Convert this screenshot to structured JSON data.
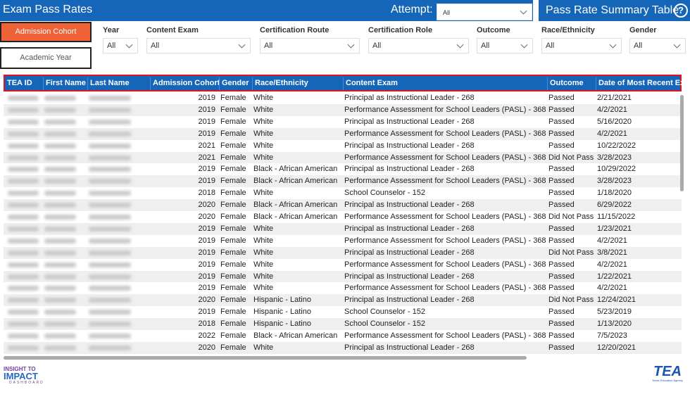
{
  "header": {
    "title": "Exam Pass Rates",
    "attempt_label": "Attempt:",
    "attempt_value": "All",
    "summary_button": "Pass Rate Summary Table",
    "help": "?"
  },
  "toggles": {
    "admission_cohort": "Admission Cohort",
    "academic_year": "Academic Year"
  },
  "filters": [
    {
      "label": "Year",
      "value": "All"
    },
    {
      "label": "Content Exam",
      "value": "All"
    },
    {
      "label": "Certification Route",
      "value": "All"
    },
    {
      "label": "Certification Role",
      "value": "All"
    },
    {
      "label": "Outcome",
      "value": "All"
    },
    {
      "label": "Race/Ethnicity",
      "value": "All"
    },
    {
      "label": "Gender",
      "value": "All"
    }
  ],
  "table": {
    "columns": [
      "TEA ID",
      "First Name",
      "Last Name",
      "Admission Cohort",
      "Gender",
      "Race/Ethnicity",
      "Content Exam",
      "Outcome",
      "Date of Most Recent Exam"
    ],
    "rows": [
      [
        "2019",
        "Female",
        "White",
        "Principal as Instructional Leader - 268",
        "Passed",
        "2/21/2021"
      ],
      [
        "2019",
        "Female",
        "White",
        "Performance Assessment for School Leaders (PASL) - 368",
        "Passed",
        "4/2/2021"
      ],
      [
        "2019",
        "Female",
        "White",
        "Principal as Instructional Leader - 268",
        "Passed",
        "5/16/2020"
      ],
      [
        "2019",
        "Female",
        "White",
        "Performance Assessment for School Leaders (PASL) - 368",
        "Passed",
        "4/2/2021"
      ],
      [
        "2021",
        "Female",
        "White",
        "Principal as Instructional Leader - 268",
        "Passed",
        "10/22/2022"
      ],
      [
        "2021",
        "Female",
        "White",
        "Performance Assessment for School Leaders (PASL) - 368",
        "Did Not Pass",
        "3/28/2023"
      ],
      [
        "2019",
        "Female",
        "Black - African American",
        "Principal as Instructional Leader - 268",
        "Passed",
        "10/29/2022"
      ],
      [
        "2019",
        "Female",
        "Black - African American",
        "Performance Assessment for School Leaders (PASL) - 368",
        "Passed",
        "3/28/2023"
      ],
      [
        "2018",
        "Female",
        "White",
        "School Counselor - 152",
        "Passed",
        "1/18/2020"
      ],
      [
        "2020",
        "Female",
        "Black - African American",
        "Principal as Instructional Leader - 268",
        "Passed",
        "6/29/2022"
      ],
      [
        "2020",
        "Female",
        "Black - African American",
        "Performance Assessment for School Leaders (PASL) - 368",
        "Did Not Pass",
        "11/15/2022"
      ],
      [
        "2019",
        "Female",
        "White",
        "Principal as Instructional Leader - 268",
        "Passed",
        "1/23/2021"
      ],
      [
        "2019",
        "Female",
        "White",
        "Performance Assessment for School Leaders (PASL) - 368",
        "Passed",
        "4/2/2021"
      ],
      [
        "2019",
        "Female",
        "White",
        "Principal as Instructional Leader - 268",
        "Did Not Pass",
        "3/8/2021"
      ],
      [
        "2019",
        "Female",
        "White",
        "Performance Assessment for School Leaders (PASL) - 368",
        "Passed",
        "4/2/2021"
      ],
      [
        "2019",
        "Female",
        "White",
        "Principal as Instructional Leader - 268",
        "Passed",
        "1/22/2021"
      ],
      [
        "2019",
        "Female",
        "White",
        "Performance Assessment for School Leaders (PASL) - 368",
        "Passed",
        "4/2/2021"
      ],
      [
        "2020",
        "Female",
        "Hispanic - Latino",
        "Principal as Instructional Leader - 268",
        "Did Not Pass",
        "12/24/2021"
      ],
      [
        "2019",
        "Female",
        "Hispanic - Latino",
        "School Counselor - 152",
        "Passed",
        "5/23/2019"
      ],
      [
        "2018",
        "Female",
        "Hispanic - Latino",
        "School Counselor - 152",
        "Passed",
        "1/13/2020"
      ],
      [
        "2022",
        "Female",
        "Black - African American",
        "Performance Assessment for School Leaders (PASL) - 368",
        "Passed",
        "7/5/2023"
      ],
      [
        "2020",
        "Female",
        "White",
        "Principal as Instructional Leader - 268",
        "Passed",
        "12/20/2021"
      ]
    ]
  },
  "footer": {
    "left_logo": "INSIGHT TO IMPACT DASHBOARD",
    "right_logo": "TEA Texas Education Agency"
  },
  "colors": {
    "brand": "#1565b8",
    "accent": "#ef6137",
    "highlight": "#e0141e"
  }
}
